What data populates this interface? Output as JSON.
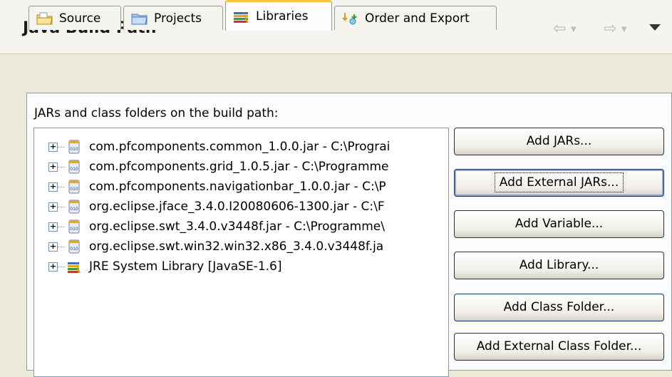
{
  "header": {
    "title": "Java Build Path"
  },
  "tabs": [
    {
      "label": "Source",
      "icon": "source-folder-icon"
    },
    {
      "label": "Projects",
      "icon": "project-folder-icon"
    },
    {
      "label": "Libraries",
      "icon": "libraries-icon",
      "active": true
    },
    {
      "label": "Order and Export",
      "icon": "order-export-icon"
    }
  ],
  "libraries": {
    "section_label": "JARs and class folders on the build path:",
    "entries": [
      {
        "text": "com.pfcomponents.common_1.0.0.jar - C:\\Prograi",
        "icon": "jar-icon"
      },
      {
        "text": "com.pfcomponents.grid_1.0.5.jar - C:\\Programme",
        "icon": "jar-icon"
      },
      {
        "text": "com.pfcomponents.navigationbar_1.0.0.jar - C:\\P",
        "icon": "jar-icon"
      },
      {
        "text": "org.eclipse.jface_3.4.0.I20080606-1300.jar - C:\\F",
        "icon": "jar-icon"
      },
      {
        "text": "org.eclipse.swt_3.4.0.v3448f.jar - C:\\Programme\\",
        "icon": "jar-icon"
      },
      {
        "text": "org.eclipse.swt.win32.win32.x86_3.4.0.v3448f.ja",
        "icon": "jar-icon"
      },
      {
        "text": "JRE System Library [JavaSE-1.6]",
        "icon": "library-icon"
      }
    ]
  },
  "buttons": {
    "add_jars": "Add JARs...",
    "add_external_jars": "Add External JARs...",
    "add_variable": "Add Variable...",
    "add_library": "Add Library...",
    "add_class_folder": "Add Class Folder...",
    "add_external_class_folder": "Add External Class Folder..."
  }
}
